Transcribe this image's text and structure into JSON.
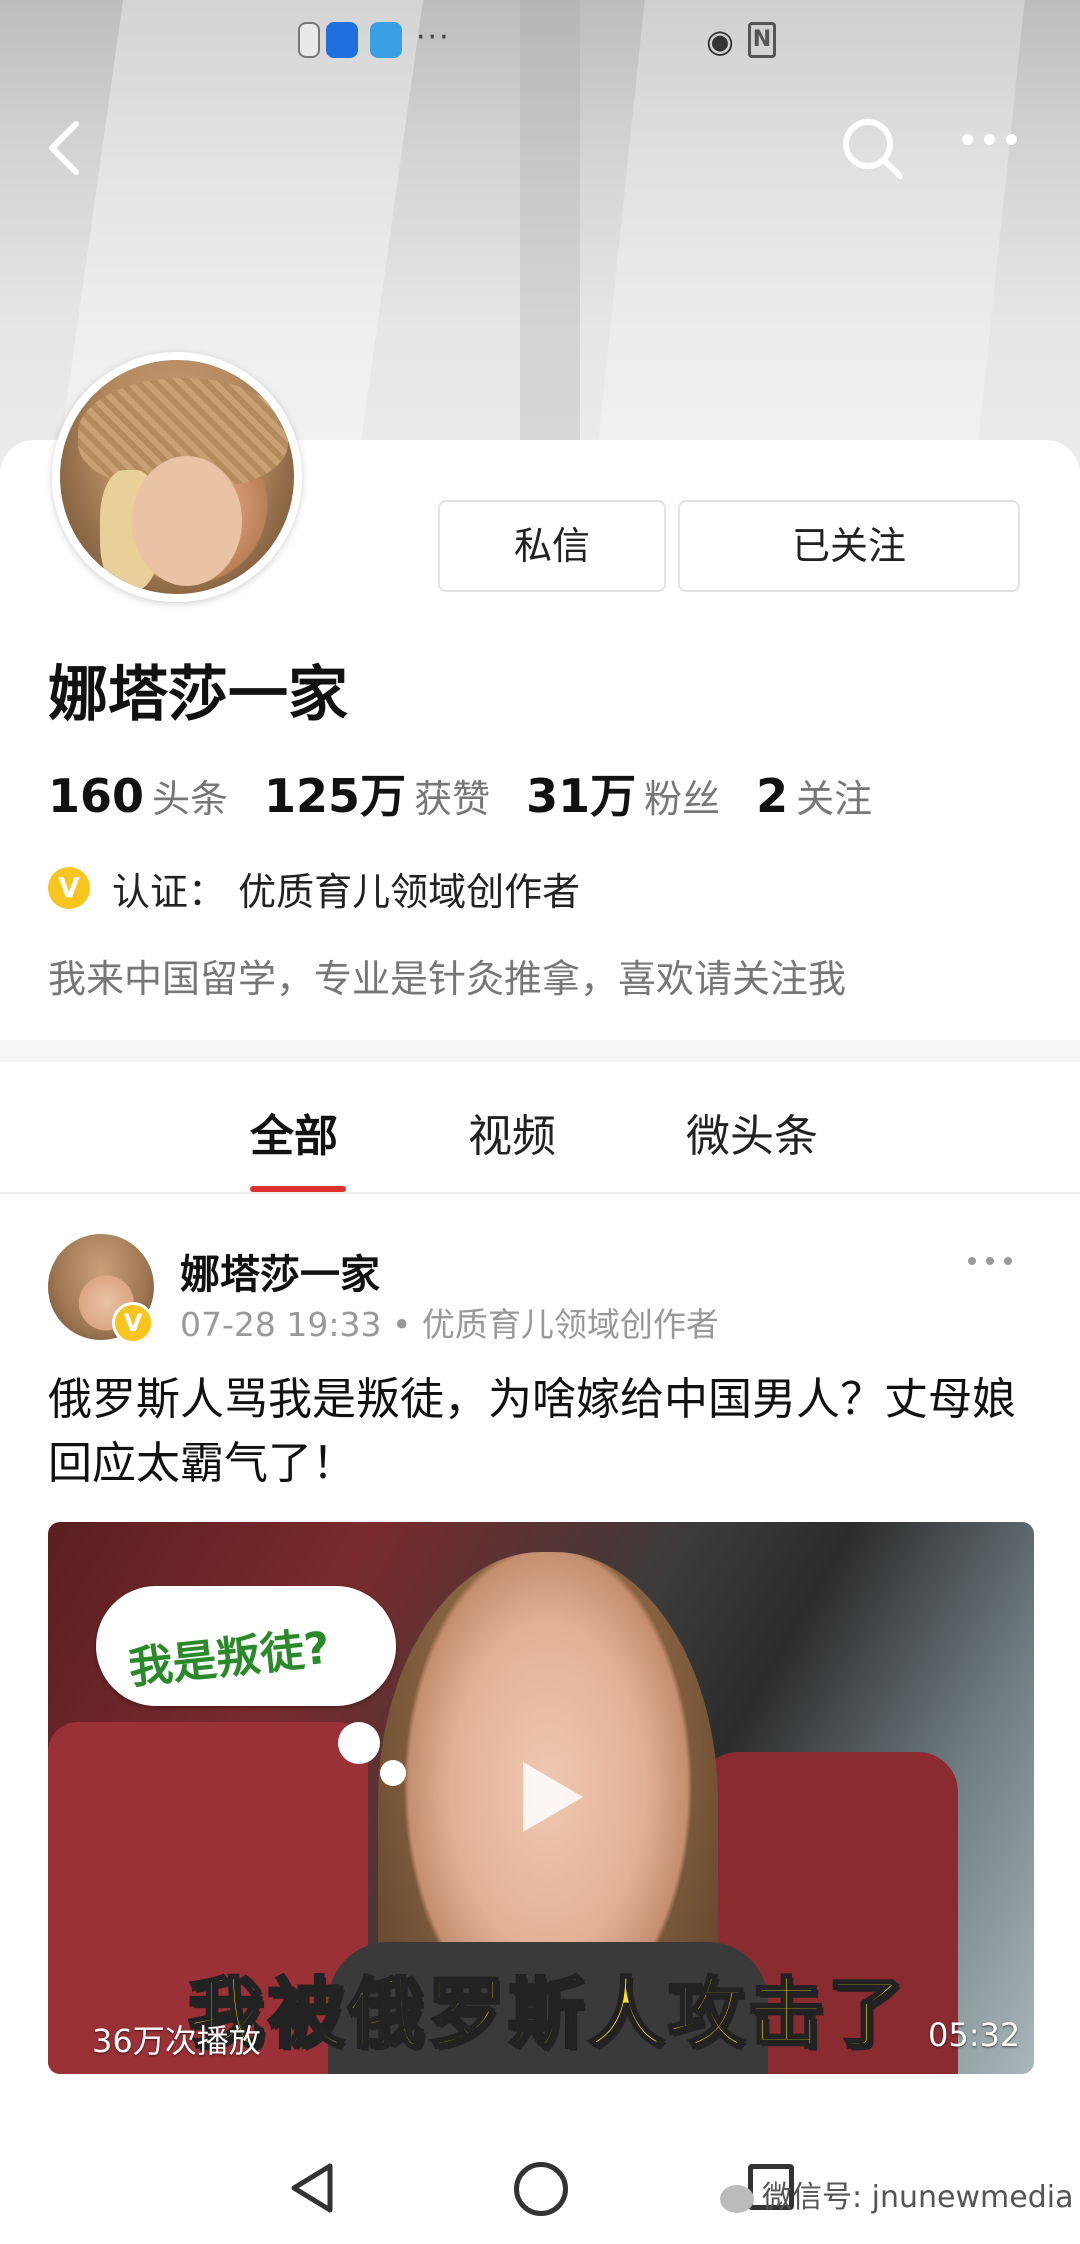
{
  "status_bar": {
    "icons": [
      "notification-icon",
      "bulb-app-icon",
      "browser-app-icon",
      "more-dots"
    ],
    "dots": "···"
  },
  "nav": {
    "back_icon": "chevron-left-icon",
    "search_icon": "search-icon",
    "more_icon": "more-dots-icon"
  },
  "profile": {
    "name": "娜塔莎一家",
    "message_button": "私信",
    "follow_button": "已关注",
    "stats": [
      {
        "value": "160",
        "label": "头条"
      },
      {
        "value": "125万",
        "label": "获赞"
      },
      {
        "value": "31万",
        "label": "粉丝"
      },
      {
        "value": "2",
        "label": "关注"
      }
    ],
    "verify_badge": "V",
    "verification": "认证： 优质育儿领域创作者",
    "bio": "我来中国留学，专业是针灸推拿，喜欢请关注我"
  },
  "tabs": [
    {
      "label": "全部",
      "active": true
    },
    {
      "label": "视频",
      "active": false
    },
    {
      "label": "微头条",
      "active": false
    }
  ],
  "post": {
    "author": "娜塔莎一家",
    "badge": "V",
    "meta": "07-28 19:33 • 优质育儿领域创作者",
    "title": "俄罗斯人骂我是叛徒，为啥嫁给中国男人？丈母娘回应太霸气了！",
    "video": {
      "bubble_text": "我是叛徒?",
      "caption": "我被俄罗斯人攻击了",
      "plays": "36万次播放",
      "duration": "05:32"
    }
  },
  "bottom_nav": {
    "icons": [
      "back-triangle-icon",
      "home-circle-icon",
      "recent-square-icon"
    ]
  },
  "watermark": "微信号: jnunewmedia",
  "colors": {
    "accent": "#e0302b",
    "verify": "#f7c51e",
    "caption": "#ffe11a"
  }
}
